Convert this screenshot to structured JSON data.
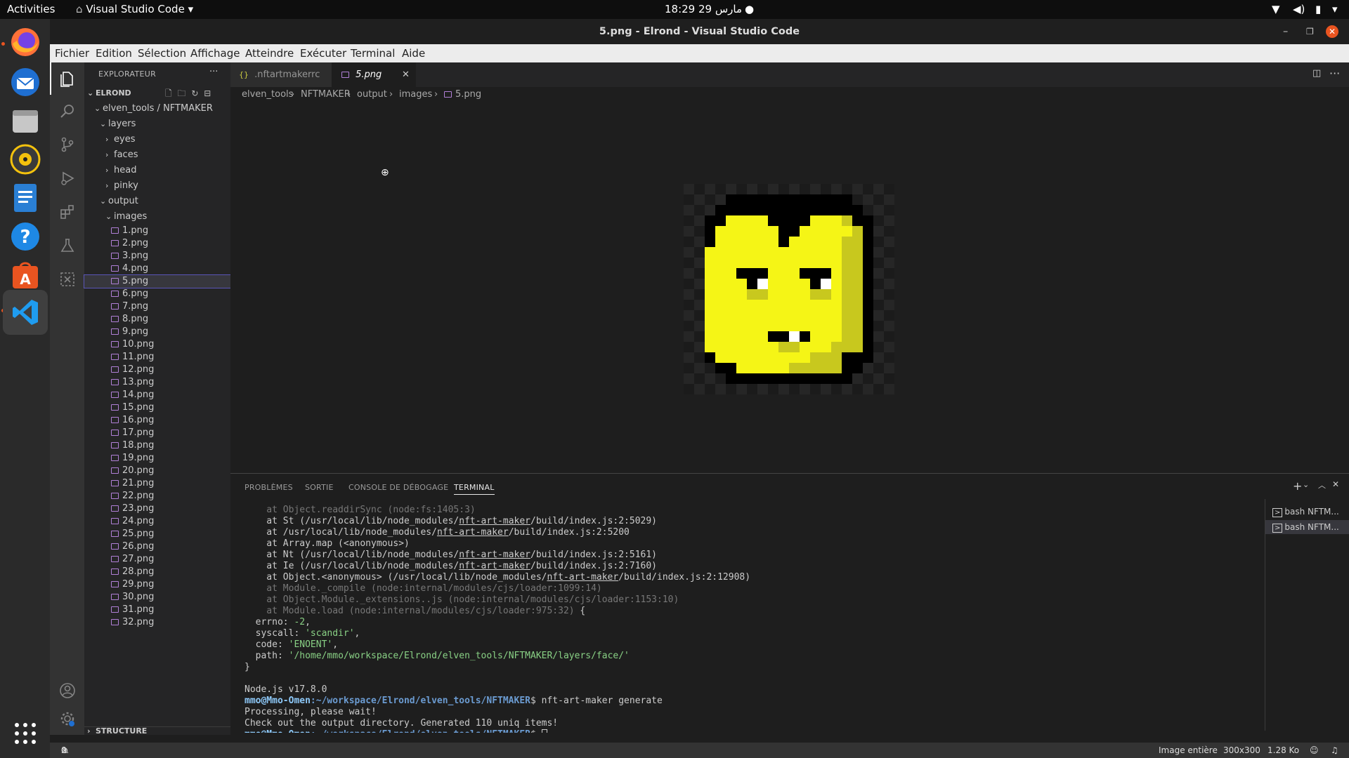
{
  "topbar": {
    "activities": "Activities",
    "app_name": "Visual Studio Code",
    "clock": "18:29  29 مارس"
  },
  "window": {
    "title": "5.png - Elrond - Visual Studio Code"
  },
  "menu": [
    "Fichier",
    "Edition",
    "Sélection",
    "Affichage",
    "Atteindre",
    "Exécuter",
    "Terminal",
    "Aide"
  ],
  "explorer": {
    "header": "EXPLORATEUR",
    "root": "ELROND",
    "project": "elven_tools / NFTMAKER",
    "layers": "layers",
    "layer_items": [
      "eyes",
      "faces",
      "head",
      "pinky"
    ],
    "output": "output",
    "images": "images",
    "files": [
      "1.png",
      "2.png",
      "3.png",
      "4.png",
      "5.png",
      "6.png",
      "7.png",
      "8.png",
      "9.png",
      "10.png",
      "11.png",
      "12.png",
      "13.png",
      "14.png",
      "15.png",
      "16.png",
      "17.png",
      "18.png",
      "19.png",
      "20.png",
      "21.png",
      "22.png",
      "23.png",
      "24.png",
      "25.png",
      "26.png",
      "27.png",
      "28.png",
      "29.png",
      "30.png",
      "31.png",
      "32.png"
    ],
    "selected_file": "5.png",
    "structure": "STRUCTURE"
  },
  "tabs": [
    {
      "label": ".nftartmakerrc",
      "icon": "json-icon"
    },
    {
      "label": "5.png",
      "icon": "image-icon",
      "active": true
    }
  ],
  "breadcrumb": [
    "elven_tools",
    "NFTMAKER",
    "output",
    "images",
    "5.png"
  ],
  "panel": {
    "tabs": [
      "PROBLÈMES",
      "SORTIE",
      "CONSOLE DE DÉBOGAGE",
      "TERMINAL"
    ],
    "active_tab": "TERMINAL",
    "terminals": [
      "bash NFTM...",
      "bash NFTM..."
    ]
  },
  "terminal": {
    "lines": {
      "l1": "    at Object.readdirSync (node:fs:1405:3)",
      "l2a": "    at St (/usr/local/lib/node_modules/",
      "l2b": "nft-art-maker",
      "l2c": "/build/index.js:2:5029)",
      "l3a": "    at /usr/local/lib/node_modules/",
      "l3b": "nft-art-maker",
      "l3c": "/build/index.js:2:5200",
      "l4": "    at Array.map (<anonymous>)",
      "l5a": "    at Nt (/usr/local/lib/node_modules/",
      "l5b": "nft-art-maker",
      "l5c": "/build/index.js:2:5161)",
      "l6a": "    at Ie (/usr/local/lib/node_modules/",
      "l6b": "nft-art-maker",
      "l6c": "/build/index.js:2:7160)",
      "l7a": "    at Object.<anonymous> (/usr/local/lib/node_modules/",
      "l7b": "nft-art-maker",
      "l7c": "/build/index.js:2:12908)",
      "l8": "    at Module._compile (node:internal/modules/cjs/loader:1099:14)",
      "l9": "    at Object.Module._extensions..js (node:internal/modules/cjs/loader:1153:10)",
      "l10a": "    at Module.load (node:internal/modules/cjs/loader:975:32)",
      "l10b": " {",
      "l11a": "  errno: ",
      "l11b": "-2",
      "l12a": "  syscall: ",
      "l12b": "'scandir'",
      "l13a": "  code: ",
      "l13b": "'ENOENT'",
      "l14a": "  path: ",
      "l14b": "'/home/mmo/workspace/Elrond/elven_tools/NFTMAKER/layers/face/'",
      "l15": "}",
      "l16": "",
      "l17": "Node.js v17.8.0",
      "prompt_user": "mmo@Mmo-Omen",
      "prompt_path": ":~/workspace/Elrond/elven_tools/NFTMAKER",
      "cmd": "$ nft-art-maker generate",
      "l19": "Processing, please wait!",
      "l20": "Check out the output directory. Generated 110 uniq items!",
      "prompt_end": "$ "
    }
  },
  "statusbar": {
    "errors": "0",
    "warnings": "0",
    "image_mode": "Image entière",
    "dimensions": "300x300",
    "size": "1.28 Ko"
  },
  "colors": {
    "face_yellow": "#f5f516",
    "face_shade": "#c8c81e",
    "accent_purple": "#b180d7"
  }
}
